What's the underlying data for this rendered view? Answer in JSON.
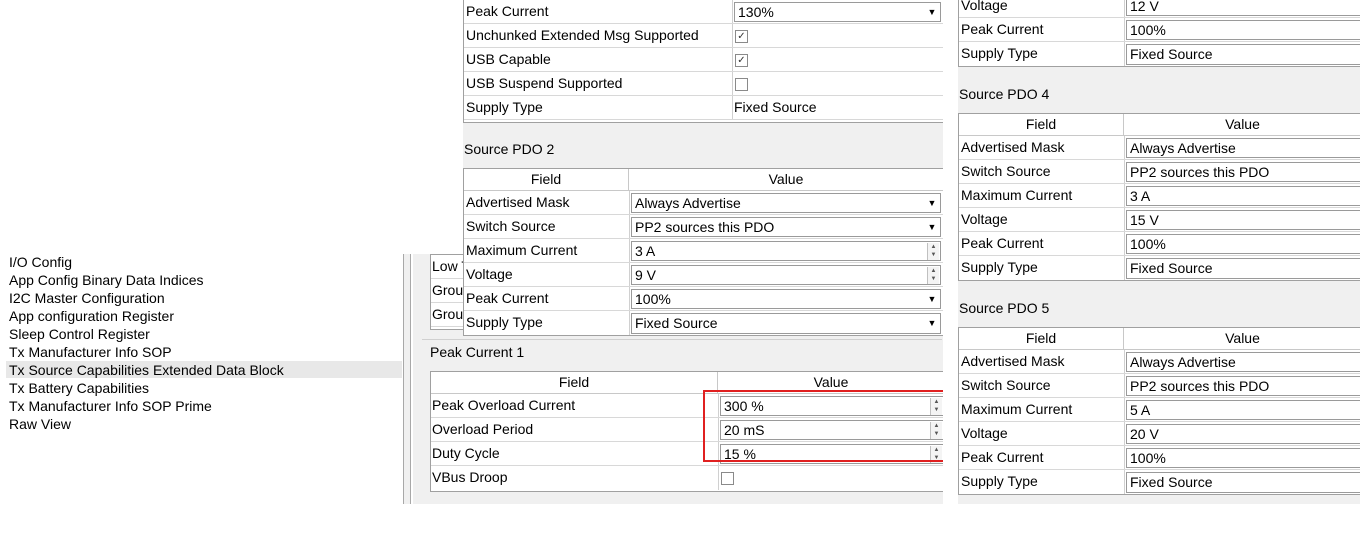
{
  "tree": {
    "items": [
      {
        "label": "I/O Config"
      },
      {
        "label": "App Config Binary Data Indices"
      },
      {
        "label": "I2C Master Configuration"
      },
      {
        "label": "App configuration Register"
      },
      {
        "label": "Sleep Control Register"
      },
      {
        "label": "Tx Manufacturer Info SOP"
      },
      {
        "label": "Tx Source Capabilities Extended Data Block",
        "selected": true
      },
      {
        "label": "Tx Battery Capabilities"
      },
      {
        "label": "Tx Manufacturer Info SOP Prime"
      },
      {
        "label": "Raw View"
      }
    ]
  },
  "cols": {
    "field": "Field",
    "value": "Value"
  },
  "pdo1_tail": {
    "rows": [
      {
        "field": "Peak Current",
        "value": "130%",
        "kind": "dropdown"
      },
      {
        "field": "Unchunked Extended Msg Supported",
        "kind": "check",
        "checked": true
      },
      {
        "field": "USB Capable",
        "kind": "check",
        "checked": true
      },
      {
        "field": "USB Suspend Supported",
        "kind": "check",
        "checked": false
      },
      {
        "field": "Supply Type",
        "value": "Fixed Source",
        "kind": "text"
      }
    ]
  },
  "pdo2": {
    "title": "Source PDO 2",
    "rows": [
      {
        "field": "Advertised Mask",
        "value": "Always Advertise"
      },
      {
        "field": "Switch Source",
        "value": "PP2 sources this PDO"
      },
      {
        "field": "Maximum Current",
        "value": "3 A"
      },
      {
        "field": "Voltage",
        "value": "9 V"
      },
      {
        "field": "Peak Current",
        "value": "100%"
      },
      {
        "field": "Supply Type",
        "value": "Fixed Source"
      }
    ]
  },
  "behind_rows": [
    "Low T",
    "Grou",
    "Grou"
  ],
  "peak_current": {
    "title": "Peak Current 1",
    "rows": [
      {
        "field": "Peak Overload Current",
        "value": "300 %"
      },
      {
        "field": "Overload Period",
        "value": "20 mS"
      },
      {
        "field": "Duty Cycle",
        "value": "15 %"
      },
      {
        "field": "VBus Droop",
        "checked": false
      }
    ],
    "highlight_color": "#e02020"
  },
  "pdo3_tail": {
    "rows": [
      {
        "field": "Voltage",
        "value": "12 V"
      },
      {
        "field": "Peak Current",
        "value": "100%"
      },
      {
        "field": "Supply Type",
        "value": "Fixed Source"
      }
    ]
  },
  "pdo4": {
    "title": "Source PDO 4",
    "rows": [
      {
        "field": "Advertised Mask",
        "value": "Always Advertise"
      },
      {
        "field": "Switch Source",
        "value": "PP2 sources this PDO"
      },
      {
        "field": "Maximum Current",
        "value": "3 A"
      },
      {
        "field": "Voltage",
        "value": "15 V"
      },
      {
        "field": "Peak Current",
        "value": "100%"
      },
      {
        "field": "Supply Type",
        "value": "Fixed Source"
      }
    ]
  },
  "pdo5": {
    "title": "Source PDO 5",
    "rows": [
      {
        "field": "Advertised Mask",
        "value": "Always Advertise"
      },
      {
        "field": "Switch Source",
        "value": "PP2 sources this PDO"
      },
      {
        "field": "Maximum Current",
        "value": "5 A"
      },
      {
        "field": "Voltage",
        "value": "20 V"
      },
      {
        "field": "Peak Current",
        "value": "100%"
      },
      {
        "field": "Supply Type",
        "value": "Fixed Source"
      }
    ]
  }
}
